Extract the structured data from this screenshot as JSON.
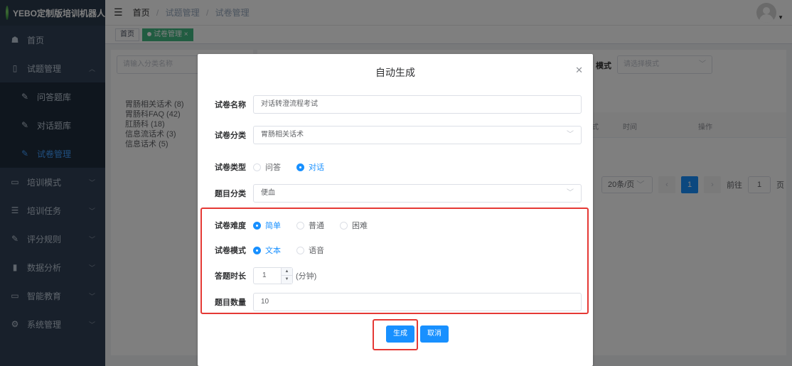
{
  "sidebar": {
    "brand": "YEBO定制版培训机器人",
    "items": [
      {
        "label": "首页",
        "icon": "dashboard-icon"
      },
      {
        "label": "试题管理",
        "icon": "book-icon"
      },
      {
        "label": "问答题库",
        "icon": "edit-icon"
      },
      {
        "label": "对话题库",
        "icon": "edit-icon"
      },
      {
        "label": "试卷管理",
        "icon": "edit-icon"
      },
      {
        "label": "培训模式",
        "icon": "monitor-icon"
      },
      {
        "label": "培训任务",
        "icon": "list-icon"
      },
      {
        "label": "评分规则",
        "icon": "edit-icon"
      },
      {
        "label": "数据分析",
        "icon": "chart-icon"
      },
      {
        "label": "智能教育",
        "icon": "monitor-icon"
      },
      {
        "label": "系统管理",
        "icon": "gear-icon"
      }
    ]
  },
  "header": {
    "breadcrumb": [
      "首页",
      "试题管理",
      "试卷管理"
    ]
  },
  "tags": {
    "home": "首页",
    "active": "试卷管理"
  },
  "left_panel": {
    "search_placeholder": "请输入分类名称",
    "tree": [
      "胃肠相关话术 (8)",
      "胃肠科FAQ (42)",
      "肛肠科 (18)",
      "信息流话术 (3)",
      "信息话术 (5)"
    ]
  },
  "right_panel": {
    "mode_label": "模式",
    "mode_placeholder": "请选择模式",
    "table_headers": [
      "式",
      "时间",
      "操作"
    ],
    "pagination": {
      "page_size": "20条/页",
      "current": "1",
      "goto_prefix": "前往",
      "goto_value": "1",
      "goto_suffix": "页"
    }
  },
  "dialog": {
    "title": "自动生成",
    "fields": {
      "name_label": "试卷名称",
      "name_value": "对话转澄流程考试",
      "category_label": "试卷分类",
      "category_value": "胃肠相关话术",
      "type_label": "试卷类型",
      "type_options": [
        "问答",
        "对话"
      ],
      "subject_label": "题目分类",
      "subject_value": "便血",
      "difficulty_label": "试卷难度",
      "difficulty_options": [
        "简单",
        "普通",
        "困难"
      ],
      "mode_label": "试卷模式",
      "mode_options": [
        "文本",
        "语音"
      ],
      "duration_label": "答题时长",
      "duration_value": "1",
      "duration_unit": "(分钟)",
      "count_label": "题目数量",
      "count_value": "10"
    },
    "generate_button": "生成",
    "cancel_button": "取消"
  },
  "colors": {
    "primary": "#1890ff",
    "sidebar_bg": "#304156",
    "highlight": "#e53935",
    "tag_active": "#42b983"
  }
}
